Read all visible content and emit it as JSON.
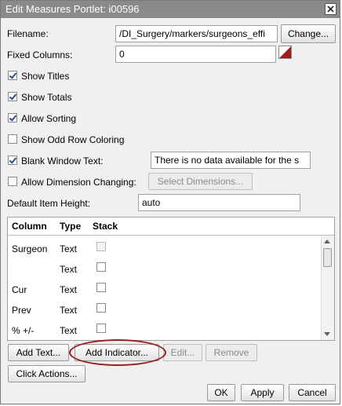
{
  "dialog": {
    "title": "Edit Measures Portlet: i00596",
    "close_icon": "close-icon"
  },
  "filename": {
    "label": "Filename:",
    "value": "/DI_Surgery/markers/surgeons_effi",
    "change_button": "Change..."
  },
  "fixed_columns": {
    "label": "Fixed Columns:",
    "value": "0"
  },
  "options": {
    "show_titles": {
      "label": "Show Titles",
      "checked": true
    },
    "show_totals": {
      "label": "Show Totals",
      "checked": true
    },
    "allow_sorting": {
      "label": "Allow Sorting",
      "checked": true
    },
    "show_odd_row_coloring": {
      "label": "Show Odd Row Coloring",
      "checked": false
    },
    "blank_window_text": {
      "label": "Blank Window Text:",
      "checked": true,
      "value": "There is no data available for the s"
    },
    "allow_dimension_changing": {
      "label": "Allow Dimension Changing:",
      "checked": false,
      "button": "Select Dimensions..."
    }
  },
  "default_item_height": {
    "label": "Default Item Height:",
    "value": "auto"
  },
  "columns_grid": {
    "headers": [
      "Column",
      "Type",
      "Stack"
    ],
    "rows": [
      {
        "column": "Surgeon",
        "type": "Text",
        "stack": false
      },
      {
        "column": "",
        "type": "Text",
        "stack": false
      },
      {
        "column": "Cur",
        "type": "Text",
        "stack": false
      },
      {
        "column": "Prev",
        "type": "Text",
        "stack": false
      },
      {
        "column": "% +/-",
        "type": "Text",
        "stack": false
      }
    ]
  },
  "grid_buttons": {
    "add_text": "Add Text...",
    "add_indicator": "Add Indicator...",
    "edit": "Edit...",
    "remove": "Remove",
    "click_actions": "Click Actions..."
  },
  "footer": {
    "ok": "OK",
    "apply": "Apply",
    "cancel": "Cancel"
  },
  "colors": {
    "titlebar": "#8a8a8a",
    "annotation_ring": "#9b1b1b",
    "swatch": "#a01c1c"
  }
}
